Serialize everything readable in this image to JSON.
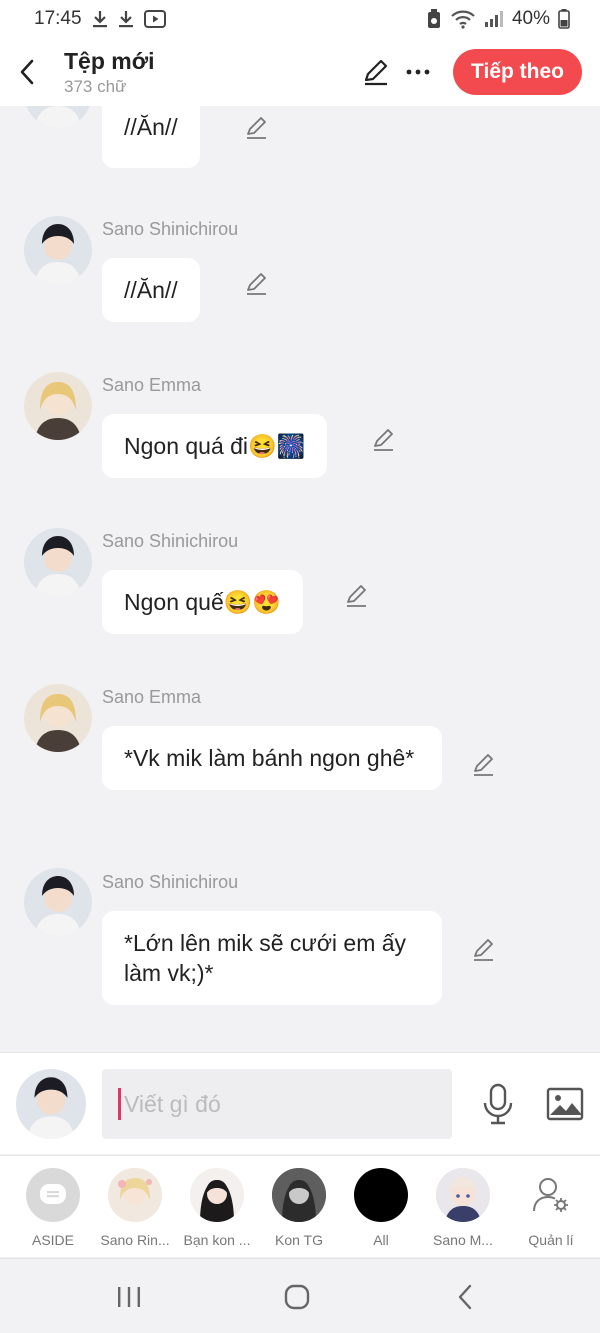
{
  "status_bar": {
    "time": "17:45",
    "battery": "40%"
  },
  "header": {
    "title": "Tệp mới",
    "word_count": "373 chữ",
    "next_label": "Tiếp theo"
  },
  "messages": [
    {
      "sender": "",
      "text": "//Ăn//",
      "avatar": "shinichirou",
      "partial": true
    },
    {
      "sender": "Sano Shinichirou",
      "text": "//Ăn//",
      "avatar": "shinichirou"
    },
    {
      "sender": "Sano Emma",
      "text": "Ngon quá đi😆🎆",
      "avatar": "emma"
    },
    {
      "sender": "Sano Shinichirou",
      "text": "Ngon quế😆😍",
      "avatar": "shinichirou"
    },
    {
      "sender": "Sano Emma",
      "text": "*Vk mik làm bánh ngon ghê*",
      "avatar": "emma"
    },
    {
      "sender": "Sano Shinichirou",
      "text": "*Lớn lên mik sẽ cưới em ấy làm vk;)*",
      "avatar": "shinichirou"
    }
  ],
  "composer": {
    "placeholder": "Viết gì đó"
  },
  "characters": [
    {
      "label": "ASIDE",
      "type": "aside"
    },
    {
      "label": "Sano Rin...",
      "type": "blonde"
    },
    {
      "label": "Bạn kon ...",
      "type": "darkhair"
    },
    {
      "label": "Kon TG",
      "type": "gray"
    },
    {
      "label": "All",
      "type": "black"
    },
    {
      "label": "Sano M...",
      "type": "silver"
    },
    {
      "label": "Quản lí",
      "type": "manage"
    }
  ],
  "colors": {
    "accent": "#f24a4f",
    "caret": "#e2336b",
    "background": "#f2f2f4"
  }
}
